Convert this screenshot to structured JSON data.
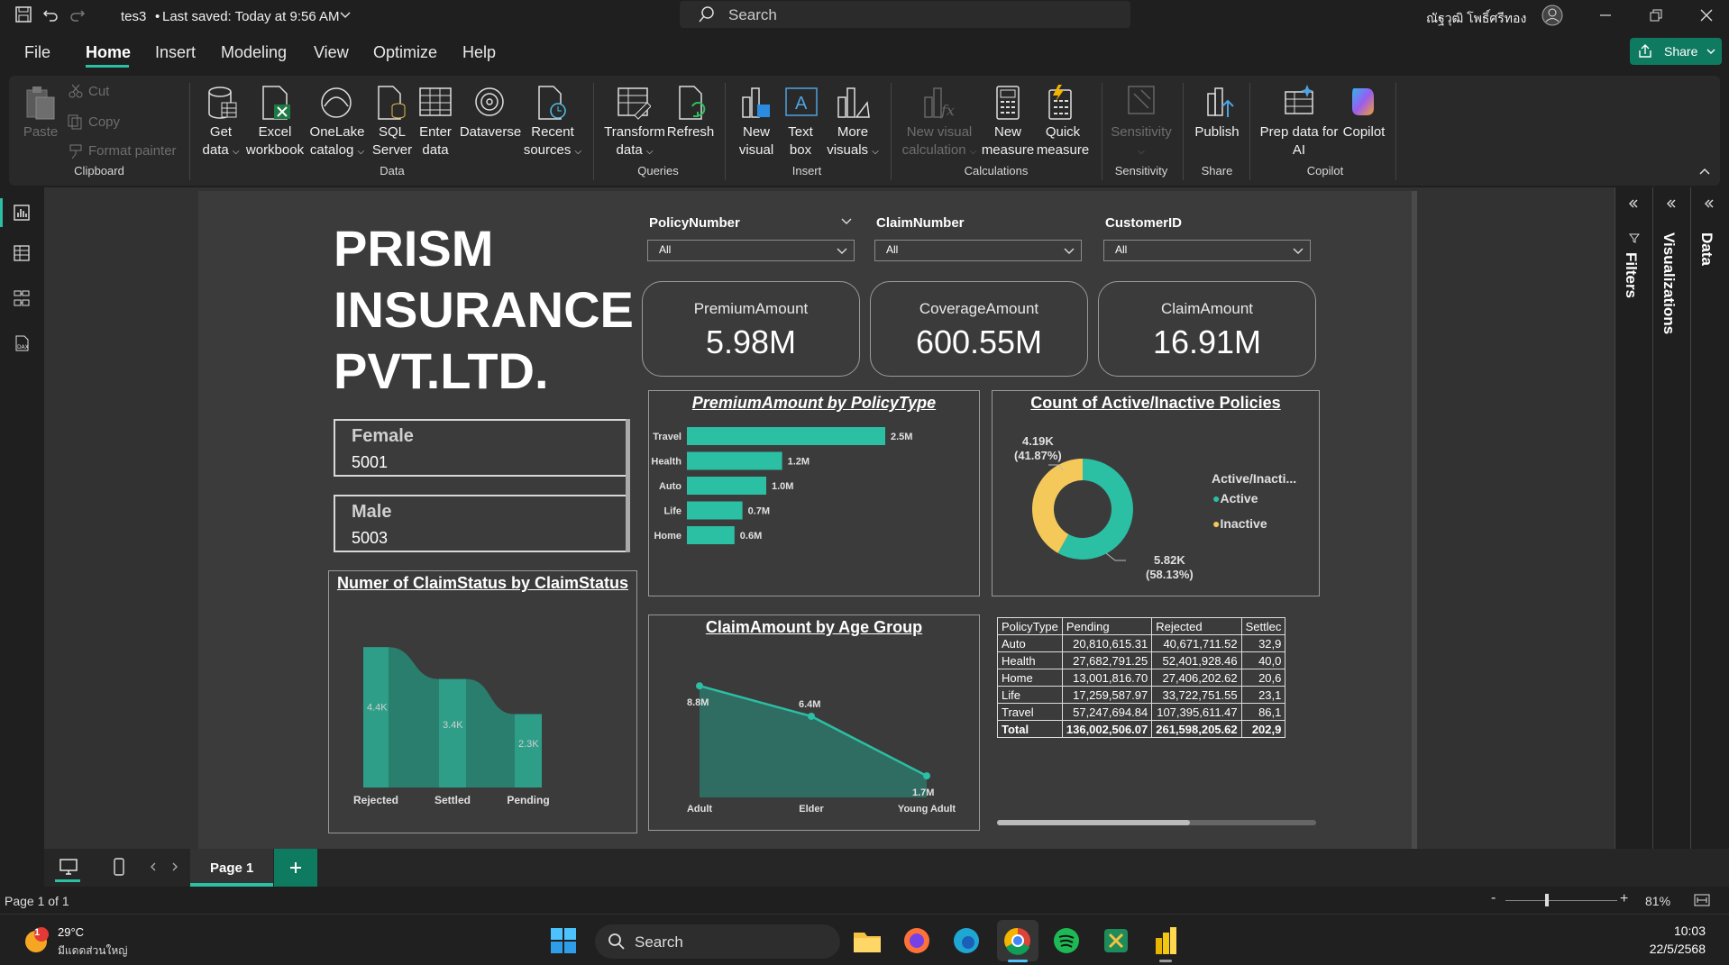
{
  "titlebar": {
    "file_name": "tes3",
    "saved": "Last saved: Today at 9:56 AM",
    "search": "Search",
    "user": "ณัฐวุฒิ โพธิ์ศรีทอง"
  },
  "menu": [
    "File",
    "Home",
    "Insert",
    "Modeling",
    "View",
    "Optimize",
    "Help"
  ],
  "share_label": "Share",
  "ribbon": {
    "clipboard": {
      "paste": "Paste",
      "cut": "Cut",
      "copy": "Copy",
      "format_painter": "Format painter",
      "group": "Clipboard"
    },
    "data": {
      "get_data": [
        "Get",
        "data"
      ],
      "excel": [
        "Excel",
        "workbook"
      ],
      "onelake": [
        "OneLake",
        "catalog"
      ],
      "sql": [
        "SQL",
        "Server"
      ],
      "enter": [
        "Enter",
        "data"
      ],
      "dataverse": "Dataverse",
      "recent": [
        "Recent",
        "sources"
      ],
      "group": "Data"
    },
    "queries": {
      "transform": [
        "Transform",
        "data"
      ],
      "refresh": "Refresh",
      "group": "Queries"
    },
    "insert": {
      "new_visual": [
        "New",
        "visual"
      ],
      "text_box": [
        "Text",
        "box"
      ],
      "more_visuals": [
        "More",
        "visuals"
      ],
      "group": "Insert"
    },
    "calculations": {
      "new_visual_calc": [
        "New visual",
        "calculation"
      ],
      "new_measure": [
        "New",
        "measure"
      ],
      "quick_measure": [
        "Quick",
        "measure"
      ],
      "group": "Calculations"
    },
    "sensitivity": {
      "label": "Sensitivity",
      "group": "Sensitivity"
    },
    "share": {
      "publish": "Publish",
      "group": "Share"
    },
    "copilot": {
      "prep": [
        "Prep data for",
        "AI"
      ],
      "copilot": "Copilot",
      "group": "Copilot"
    }
  },
  "report": {
    "title_lines": [
      "PRISM",
      "INSURANCE",
      "PVT.LTD."
    ],
    "slicers": [
      {
        "title": "PolicyNumber",
        "value": "All"
      },
      {
        "title": "ClaimNumber",
        "value": "All"
      },
      {
        "title": "CustomerID",
        "value": "All"
      }
    ],
    "cards": [
      {
        "label": "PremiumAmount",
        "value": "5.98M"
      },
      {
        "label": "CoverageAmount",
        "value": "600.55M"
      },
      {
        "label": "ClaimAmount",
        "value": "16.91M"
      }
    ],
    "gender": [
      {
        "label": "Female",
        "value": "5001"
      },
      {
        "label": "Male",
        "value": "5003"
      }
    ],
    "premium_chart": {
      "title": "PremiumAmount by PolicyType"
    },
    "donut": {
      "title": "Count of Active/Inactive Policies",
      "legend_title": "Active/Inacti...",
      "legend": [
        "Active",
        "Inactive"
      ],
      "label_inactive": [
        "4.19K",
        "(41.87%)"
      ],
      "label_active": [
        "5.82K",
        "(58.13%)"
      ]
    },
    "claimstatus": {
      "title": "Numer of ClaimStatus by ClaimStatus"
    },
    "agegroup": {
      "title": "ClaimAmount by Age Group"
    },
    "matrix": {
      "headers": [
        "PolicyType",
        "Pending",
        "Rejected",
        "Settlec"
      ],
      "rows": [
        [
          "Auto",
          "20,810,615.31",
          "40,671,711.52",
          "32,9"
        ],
        [
          "Health",
          "27,682,791.25",
          "52,401,928.46",
          "40,0"
        ],
        [
          "Home",
          "13,001,816.70",
          "27,406,202.62",
          "20,6"
        ],
        [
          "Life",
          "17,259,587.97",
          "33,722,751.55",
          "23,1"
        ],
        [
          "Travel",
          "57,247,694.84",
          "107,395,611.47",
          "86,1"
        ],
        [
          "Total",
          "136,002,506.07",
          "261,598,205.62",
          "202,9"
        ]
      ]
    }
  },
  "chart_data": [
    {
      "type": "bar",
      "title": "PremiumAmount by PolicyType",
      "categories": [
        "Travel",
        "Health",
        "Auto",
        "Life",
        "Home"
      ],
      "values": [
        2.5,
        1.2,
        1.0,
        0.7,
        0.6
      ],
      "value_labels": [
        "2.5M",
        "1.2M",
        "1.0M",
        "0.7M",
        "0.6M"
      ],
      "orientation": "horizontal",
      "color": "#2bbfa4"
    },
    {
      "type": "pie",
      "title": "Count of Active/Inactive Policies",
      "categories": [
        "Active",
        "Inactive"
      ],
      "values": [
        5820,
        4190
      ],
      "percent": [
        58.13,
        41.87
      ],
      "colors": [
        "#2bbfa4",
        "#f5c85a"
      ]
    },
    {
      "type": "area",
      "title": "Numer of ClaimStatus by ClaimStatus",
      "categories": [
        "Rejected",
        "Settled",
        "Pending"
      ],
      "values": [
        4.4,
        3.4,
        2.3
      ],
      "value_labels": [
        "4.4K",
        "3.4K",
        "2.3K"
      ],
      "color": "#2e9e88"
    },
    {
      "type": "area",
      "title": "ClaimAmount by Age Group",
      "categories": [
        "Adult",
        "Elder",
        "Young Adult"
      ],
      "values": [
        8.8,
        6.4,
        1.7
      ],
      "value_labels": [
        "8.8M",
        "6.4M",
        "1.7M"
      ],
      "color": "#2bbfa4"
    }
  ],
  "pages": {
    "tab": "Page 1"
  },
  "status": {
    "page": "Page 1 of 1",
    "zoom": "81%"
  },
  "right_panes": [
    "Filters",
    "Visualizations",
    "Data"
  ],
  "taskbar": {
    "temp": "29°C",
    "weather": "มีแดดส่วนใหญ่",
    "search": "Search",
    "time": "10:03",
    "date": "22/5/2568",
    "badge": "1"
  },
  "colors": {
    "accent": "#2bbfa4",
    "yellow": "#f5c85a",
    "share_btn": "#0e7a5f"
  }
}
